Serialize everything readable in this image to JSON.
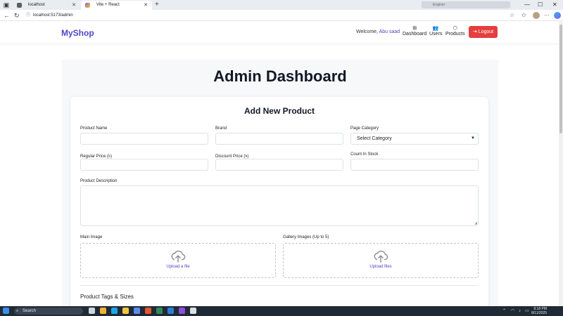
{
  "browser": {
    "tabs": [
      {
        "title": "localhost",
        "active": false
      },
      {
        "title": "Vite + React",
        "active": true
      }
    ],
    "url": "localhost:5173/admin",
    "extension_text": "Enginer"
  },
  "navbar": {
    "logo": "MyShop",
    "welcome_prefix": "Welcome,",
    "user_name": "Abu saad",
    "links": [
      {
        "label": "Dashboard",
        "icon": "grid-icon"
      },
      {
        "label": "Users",
        "icon": "users-icon"
      },
      {
        "label": "Products",
        "icon": "box-icon"
      }
    ],
    "logout_label": "Logout",
    "accent_color": "#4f46c7",
    "logout_color": "#e53e3e"
  },
  "page": {
    "title": "Admin Dashboard",
    "form_title": "Add New Product",
    "fields": {
      "product_name": {
        "label": "Product Name",
        "value": ""
      },
      "brand": {
        "label": "Brand",
        "value": ""
      },
      "page_category": {
        "label": "Page Category",
        "selected": "Select Category"
      },
      "regular_price": {
        "label": "Regular Price (৳)",
        "value": ""
      },
      "discount_price": {
        "label": "Discount Price (৳)",
        "value": ""
      },
      "count_in_stock": {
        "label": "Count In Stock",
        "value": ""
      },
      "description": {
        "label": "Product Description",
        "value": ""
      }
    },
    "main_image": {
      "label": "Main Image",
      "action": "Upload a file"
    },
    "gallery_images": {
      "label": "Gallery Images (Up to 5)",
      "action": "Upload files"
    },
    "tags_section_title": "Product Tags & Sizes"
  },
  "taskbar": {
    "search_placeholder": "Search",
    "time": "9:18 PM",
    "date": "8/11/2025"
  }
}
